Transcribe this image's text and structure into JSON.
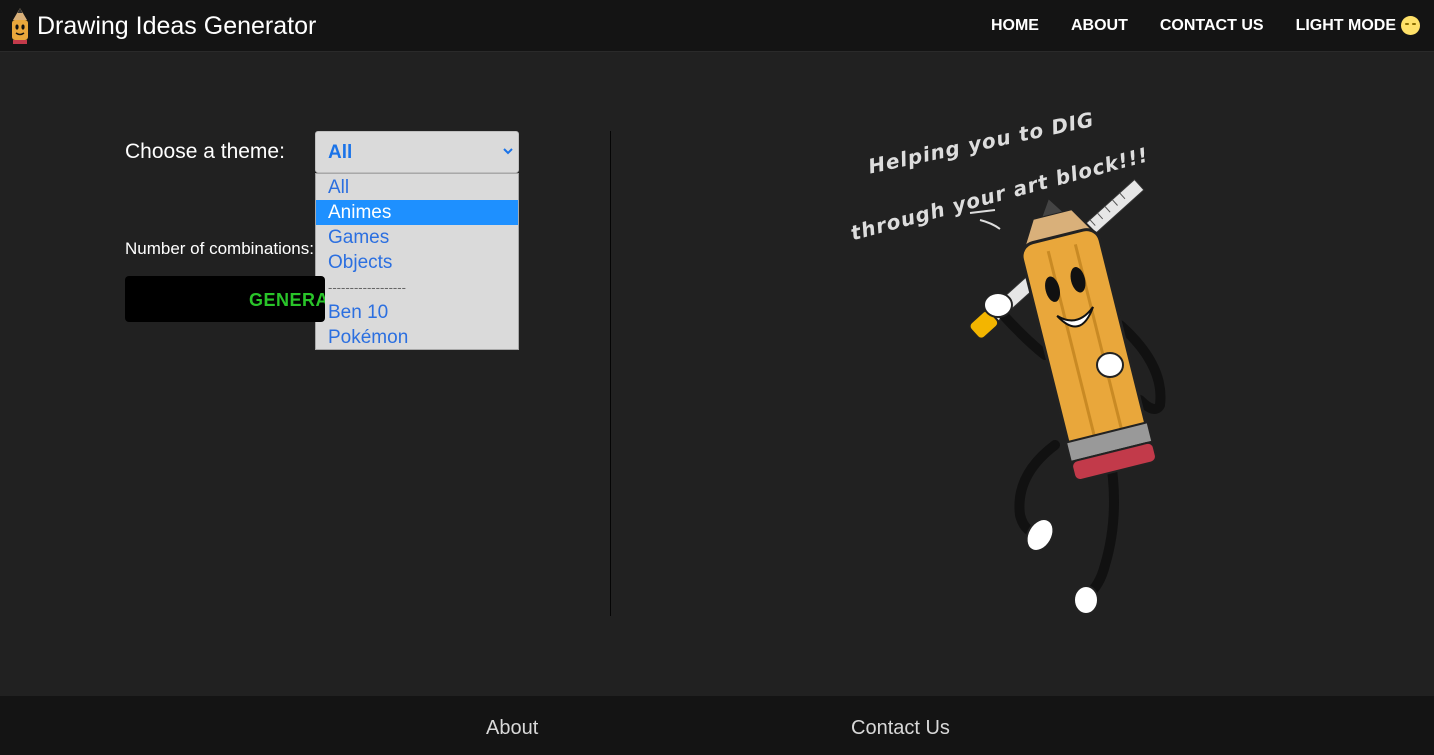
{
  "header": {
    "title": "Drawing Ideas Generator",
    "logo_icon": "pencil-mascot-icon",
    "nav": [
      {
        "label": "HOME"
      },
      {
        "label": "ABOUT"
      },
      {
        "label": "CONTACT US"
      },
      {
        "label": "LIGHT MODE",
        "icon": "moon-face-icon"
      }
    ]
  },
  "form": {
    "theme_label": "Choose a theme:",
    "theme_selected": "All",
    "theme_options": [
      "All",
      "Animes",
      "Games",
      "Objects",
      "------------------",
      "Ben 10",
      "Pokémon"
    ],
    "highlighted_option": "Animes",
    "combinations_label": "Number of combinations:",
    "generate_label": "GENERATE"
  },
  "illustration": {
    "tagline_line1": "Helping you to DIG",
    "tagline_line2": "through your art block!!!"
  },
  "footer": {
    "about_label": "About",
    "contact_label": "Contact Us"
  },
  "colors": {
    "background": "#212121",
    "navbar": "#141414",
    "accent_blue": "#1a73e8",
    "highlight": "#1e90ff",
    "generate_text": "#29c429",
    "pencil_body": "#e9a73b"
  }
}
